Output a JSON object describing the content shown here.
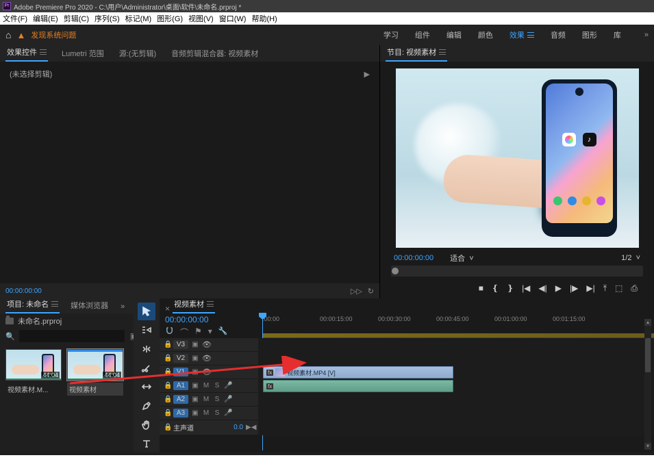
{
  "title": "Adobe Premiere Pro 2020 - C:\\用户\\Administrator\\桌面\\软件\\未命名.prproj *",
  "menu": [
    "文件(F)",
    "编辑(E)",
    "剪辑(C)",
    "序列(S)",
    "标记(M)",
    "图形(G)",
    "视图(V)",
    "窗口(W)",
    "帮助(H)"
  ],
  "warning": "发现系统问题",
  "workspaces": {
    "items": [
      "学习",
      "组件",
      "编辑",
      "颜色",
      "效果",
      "音频",
      "图形",
      "库"
    ],
    "active": "效果",
    "overflow": "»"
  },
  "leftTabs": {
    "items": [
      "效果控件",
      "Lumetri 范围",
      "源:(无剪辑)",
      "音频剪辑混合器: 视频素材"
    ],
    "active": "效果控件"
  },
  "effectsPanel": {
    "noselect": "(未选择剪辑)"
  },
  "leftStatus": {
    "tc": "00:00:00:00"
  },
  "programTab": "节目: 视频素材",
  "program": {
    "tc": "00:00:00:00",
    "fit": "适合",
    "ratio": "1/2"
  },
  "projectTabs": {
    "items": [
      "项目: 未命名",
      "媒体浏览器"
    ],
    "active": "项目: 未命名",
    "overflow": "»"
  },
  "projectBread": "未命名.prproj",
  "thumbs": [
    {
      "name": "视频素材.M...",
      "dur": "44:04",
      "selected": false,
      "seq": false
    },
    {
      "name": "视频素材",
      "dur": "44:04",
      "selected": true,
      "seq": true
    }
  ],
  "timeline": {
    "tab": "视频素材",
    "tc": "00:00:00:00",
    "ticks": [
      {
        "label": ":00:00",
        "pos": 6
      },
      {
        "label": "00:00:15:00",
        "pos": 90
      },
      {
        "label": "00:00:30:00",
        "pos": 175
      },
      {
        "label": "00:00:45:00",
        "pos": 260
      },
      {
        "label": "00:01:00:00",
        "pos": 345
      },
      {
        "label": "00:01:15:00",
        "pos": 430
      }
    ],
    "tracks": {
      "video": [
        {
          "id": "V3",
          "on": false
        },
        {
          "id": "V2",
          "on": false
        },
        {
          "id": "V1",
          "on": true
        }
      ],
      "audio": [
        {
          "id": "A1",
          "on": true
        },
        {
          "id": "A2",
          "on": true
        },
        {
          "id": "A3",
          "on": true
        }
      ]
    },
    "clipName": "视频素材.MP4 [V]",
    "master": {
      "label": "主声道",
      "value": "0.0"
    }
  },
  "audioLetters": {
    "m": "M",
    "s": "S"
  }
}
